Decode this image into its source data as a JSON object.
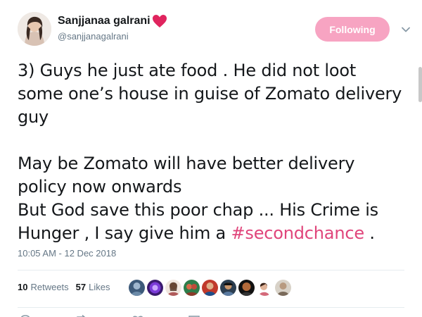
{
  "author": {
    "display_name": "Sanjjanaa galrani",
    "handle": "@sanjjanagalrani",
    "name_emoji_icon": "red-heart-icon",
    "avatar_icon": "profile-photo"
  },
  "follow_button": {
    "label": "Following",
    "color": "#f7a4c2"
  },
  "tweet": {
    "line1": "3) Guys he just ate food . He did not loot",
    "line2": "some one’s house in guise of Zomato delivery",
    "line3": "guy",
    "line4": "May be Zomato will have better delivery",
    "line5": "policy now onwards",
    "line6": "But God save this poor chap ... His Crime is",
    "line7_before": "Hunger , I say give him a ",
    "hashtag": "#secondchance",
    "line7_after": " .",
    "hashtag_color": "#e0457b"
  },
  "timestamp": "10:05 AM - 12 Dec 2018",
  "stats": {
    "retweets_count": "10",
    "retweets_label": "Retweets",
    "likes_count": "57",
    "likes_label": "Likes"
  },
  "likers_icons": [
    "liker-avatar",
    "liker-avatar",
    "liker-avatar",
    "liker-avatar",
    "liker-avatar",
    "liker-avatar",
    "liker-avatar",
    "liker-avatar",
    "liker-avatar"
  ],
  "action_icons": [
    "reply-icon",
    "retweet-icon",
    "like-icon",
    "message-icon"
  ]
}
